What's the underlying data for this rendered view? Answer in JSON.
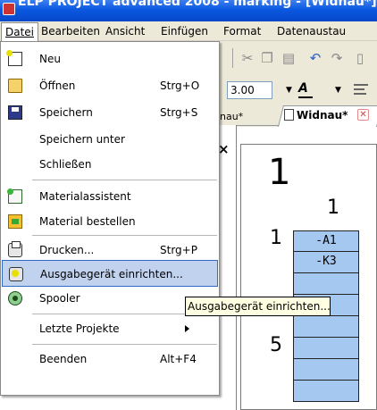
{
  "window": {
    "title": "ELP PROJECT advanced 2008 - marking - [Widnau*]"
  },
  "menubar": {
    "items": [
      {
        "label": "Datei"
      },
      {
        "label": "Bearbeiten"
      },
      {
        "label": "Ansicht"
      },
      {
        "label": "Einfügen"
      },
      {
        "label": "Format"
      },
      {
        "label": "Datenaustau"
      }
    ]
  },
  "toolbar": {
    "size_value": "3.00"
  },
  "doc_tabs": {
    "tab1": "nau*",
    "tab2": "Widnau*"
  },
  "canvas": {
    "big_number": "1",
    "column_number": "1",
    "row_numbers": [
      "1",
      "5"
    ],
    "cells": [
      "-A1",
      "-K3",
      "",
      "",
      "",
      "",
      "",
      "",
      ""
    ]
  },
  "file_menu": {
    "items": [
      {
        "label": "Neu",
        "shortcut": "",
        "icon": "new-document-icon"
      },
      {
        "label": "Öffnen",
        "shortcut": "Strg+O",
        "icon": "open-folder-icon"
      },
      {
        "label": "Speichern",
        "shortcut": "Strg+S",
        "icon": "floppy-save-icon"
      },
      {
        "label": "Speichern unter",
        "shortcut": ""
      },
      {
        "label": "Schließen",
        "shortcut": ""
      },
      {
        "label": "Materialassistent",
        "shortcut": "",
        "icon": "wizard-icon"
      },
      {
        "label": "Material bestellen",
        "shortcut": "",
        "icon": "order-icon"
      },
      {
        "label": "Drucken...",
        "shortcut": "Strg+P",
        "icon": "printer-icon"
      },
      {
        "label": "Ausgabegerät einrichten...",
        "shortcut": "",
        "icon": "printer-setup-icon"
      },
      {
        "label": "Spooler",
        "shortcut": "",
        "icon": "spooler-icon"
      },
      {
        "label": "Letzte Projekte",
        "shortcut": ""
      },
      {
        "label": "Beenden",
        "shortcut": "Alt+F4"
      }
    ]
  },
  "tooltip": {
    "text": "Ausgabegerät einrichten..."
  }
}
